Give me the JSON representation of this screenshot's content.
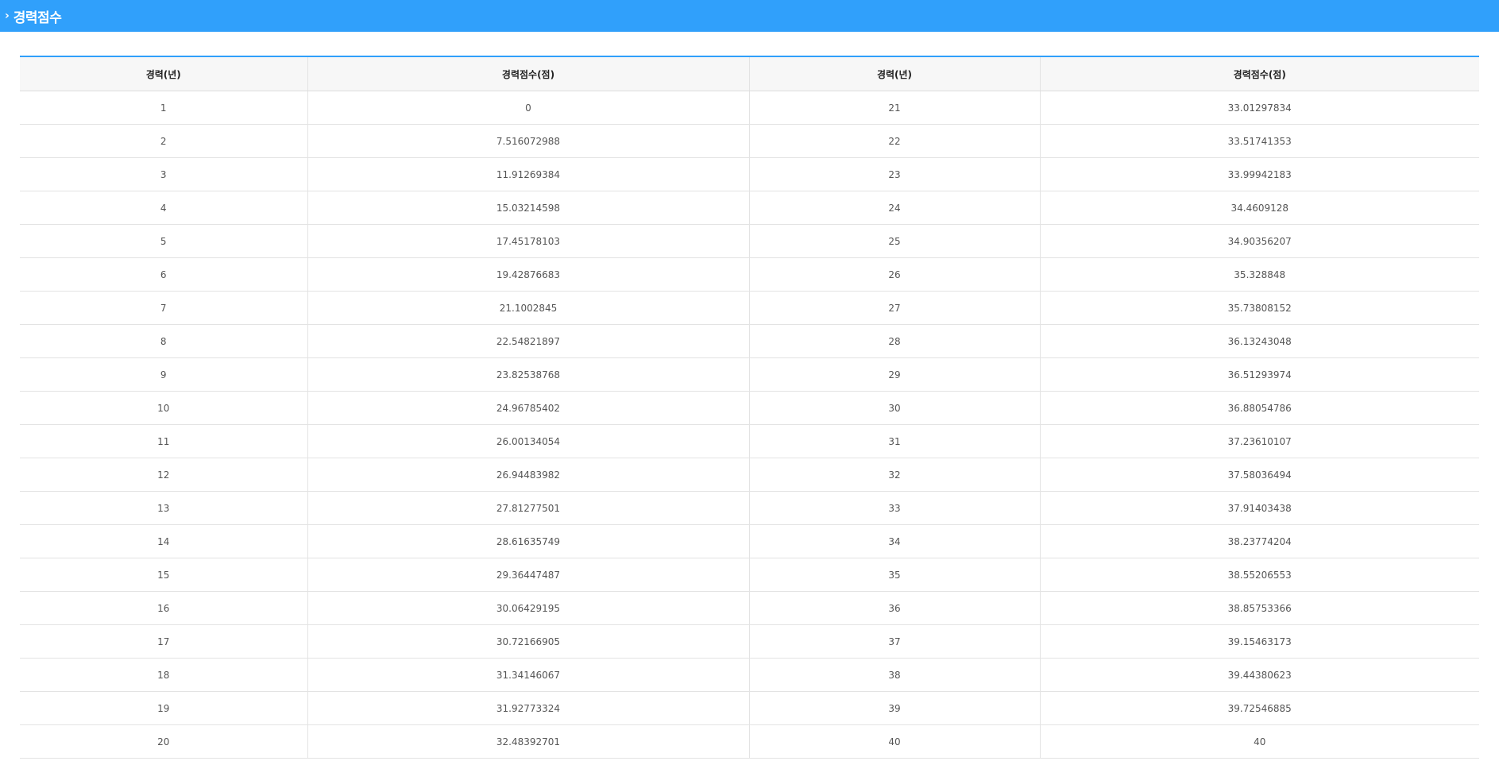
{
  "header": {
    "title": "경력점수"
  },
  "table": {
    "columns": [
      "경력(년)",
      "경력점수(점)",
      "경력(년)",
      "경력점수(점)"
    ],
    "rows": [
      [
        "1",
        "0",
        "21",
        "33.01297834"
      ],
      [
        "2",
        "7.516072988",
        "22",
        "33.51741353"
      ],
      [
        "3",
        "11.91269384",
        "23",
        "33.99942183"
      ],
      [
        "4",
        "15.03214598",
        "24",
        "34.4609128"
      ],
      [
        "5",
        "17.45178103",
        "25",
        "34.90356207"
      ],
      [
        "6",
        "19.42876683",
        "26",
        "35.328848"
      ],
      [
        "7",
        "21.1002845",
        "27",
        "35.73808152"
      ],
      [
        "8",
        "22.54821897",
        "28",
        "36.13243048"
      ],
      [
        "9",
        "23.82538768",
        "29",
        "36.51293974"
      ],
      [
        "10",
        "24.96785402",
        "30",
        "36.88054786"
      ],
      [
        "11",
        "26.00134054",
        "31",
        "37.23610107"
      ],
      [
        "12",
        "26.94483982",
        "32",
        "37.58036494"
      ],
      [
        "13",
        "27.81277501",
        "33",
        "37.91403438"
      ],
      [
        "14",
        "28.61635749",
        "34",
        "38.23774204"
      ],
      [
        "15",
        "29.36447487",
        "35",
        "38.55206553"
      ],
      [
        "16",
        "30.06429195",
        "36",
        "38.85753366"
      ],
      [
        "17",
        "30.72166905",
        "37",
        "39.15463173"
      ],
      [
        "18",
        "31.34146067",
        "38",
        "39.44380623"
      ],
      [
        "19",
        "31.92773324",
        "39",
        "39.72546885"
      ],
      [
        "20",
        "32.48392701",
        "40",
        "40"
      ]
    ]
  }
}
